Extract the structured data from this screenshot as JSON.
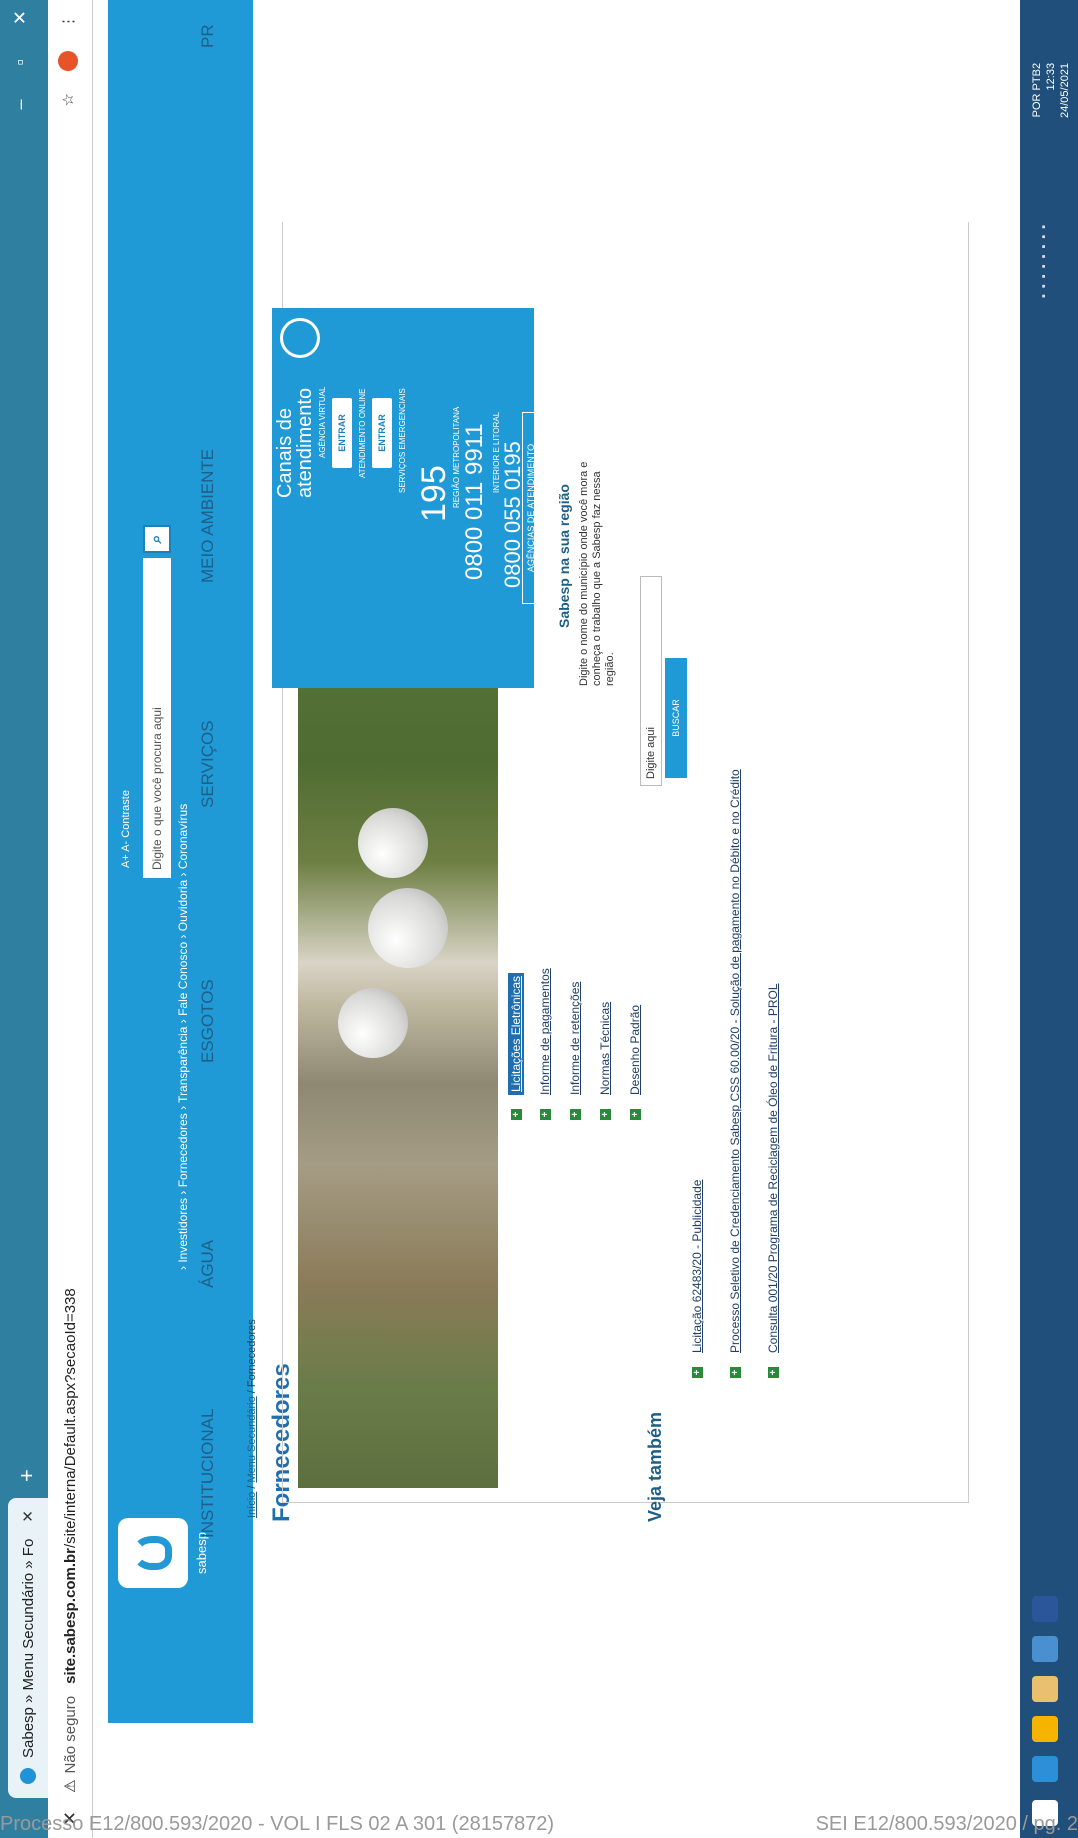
{
  "browser": {
    "tab_title": "Sabesp » Menu Secundário » Fo",
    "address_security": "Não seguro",
    "url_host": "site.sabesp.com.br",
    "url_path": "/site/interna/Default.aspx?secaoId=338"
  },
  "site": {
    "logo_text": "sabesp",
    "tools": "A+  A-   Contraste",
    "search_placeholder": "Digite o que você procura aqui",
    "top_links": "› Investidores  › Fornecedores  › Transparência  › Fale Conosco  › Ouvidoria  › Coronavírus",
    "nav": [
      "INSTITUCIONAL",
      "ÁGUA",
      "ESGOTOS",
      "SERVIÇOS",
      "MEIO AMBIENTE",
      "PR"
    ],
    "breadcrumb_home": "Início",
    "breadcrumb_mid": "Menu Secundário",
    "breadcrumb_current": "Fornecedores",
    "page_title": "Fornecedores",
    "links": [
      "Licitações Eletrônicas",
      "Informe de pagamentos",
      "Informe de retenções",
      "Normas Técnicas",
      "Desenho Padrão"
    ],
    "veja_title": "Veja também",
    "veja_links": [
      "Licitação 62483/20 - Publicidade",
      "Processo Seletivo de Credenciamento Sabesp CSS 60.00/20 - Solução de pagamento no Débito e no Crédito",
      "Consulta 001/20 Programa de Reciclagem de Óleo de Fritura - PROL"
    ]
  },
  "canais": {
    "title_1": "Canais de",
    "title_2": "atendimento",
    "agencia_virtual": "AGÊNCIA VIRTUAL",
    "entrar_1": "ENTRAR",
    "atendimento_online": "ATENDIMENTO ONLINE",
    "entrar_2": "ENTRAR",
    "servicos_emergenciais": "SERVIÇOS EMERGENCIAIS",
    "num_195": "195",
    "regiao_metropolitana": "REGIÃO METROPOLITANA",
    "num_metro": "0800 011 9911",
    "interior_litoral": "INTERIOR E LITORAL",
    "num_interior": "0800 055 0195",
    "agencias_btn": "AGÊNCIAS DE ATENDIMENTO"
  },
  "regiao": {
    "title": "Sabesp na sua região",
    "text": "Digite o nome do município onde você mora e conheça o trabalho que a Sabesp faz nessa região.",
    "input_value": "Digite aqui",
    "button": "BUSCAR"
  },
  "taskbar": {
    "lang": "POR PTB2",
    "time": "12:33",
    "date": "24/05/2021"
  },
  "footer": {
    "left": "Processo E12/800.593/2020 - VOL I FLS 02 A 301 (28157872)",
    "right": "SEI E12/800.593/2020 / pg. 2"
  },
  "colors": {
    "brand": "#1f9ad6",
    "nav_text": "#1f5f86",
    "taskbar": "#1f4f7a"
  }
}
